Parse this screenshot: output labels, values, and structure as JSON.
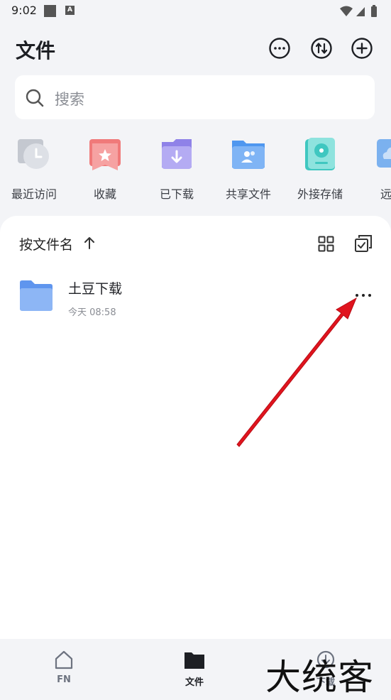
{
  "status_bar": {
    "time": "9:02"
  },
  "header": {
    "title": "文件"
  },
  "search": {
    "placeholder": "搜索"
  },
  "quick_access": [
    {
      "label": "最近访问",
      "icon": "clock-icon"
    },
    {
      "label": "收藏",
      "icon": "star-icon"
    },
    {
      "label": "已下载",
      "icon": "download-icon"
    },
    {
      "label": "共享文件",
      "icon": "shared-folder-icon"
    },
    {
      "label": "外接存储",
      "icon": "external-disk-icon"
    },
    {
      "label": "远程",
      "icon": "cloud-icon"
    }
  ],
  "list": {
    "sort_label": "按文件名",
    "files": [
      {
        "name": "土豆下载",
        "time": "今天 08:58"
      }
    ]
  },
  "bottom_nav": [
    {
      "label": "FN",
      "icon": "home-icon"
    },
    {
      "label": "文件",
      "icon": "folder-icon"
    },
    {
      "label": "下载",
      "icon": "download-icon"
    }
  ],
  "watermark": "大统客",
  "colors": {
    "accent": "#5b8def",
    "annotation_arrow": "#e0141e"
  }
}
